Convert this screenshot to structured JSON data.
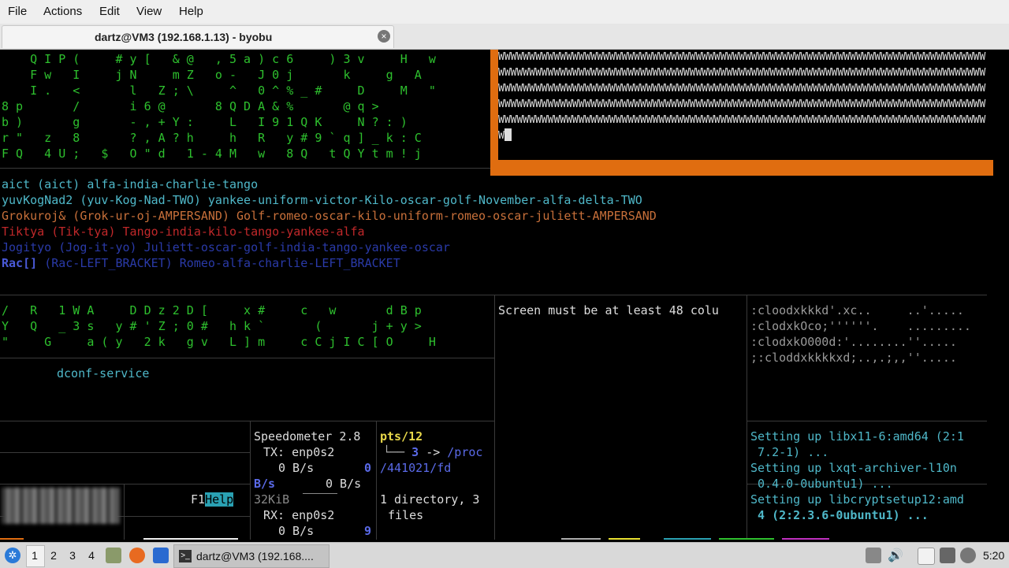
{
  "menu": {
    "file": "File",
    "actions": "Actions",
    "edit": "Edit",
    "view": "View",
    "help": "Help"
  },
  "tab": {
    "title": "dartz@VM3 (192.168.1.13) - byobu",
    "close_icon": "close-icon"
  },
  "matrix_top": [
    "    Q I P (     # y [   & @   , 5 a ) c 6     ) 3 v     H   w",
    "    F w   I     j N     m Z   o -   J 0 j       k     g   A",
    "    I .   <       l   Z ; \\     ^   0 ^ % _ #     D     M   \"",
    "8 p       /       i 6 @       8 Q D A & %       @ q >",
    "b )       g       - , + Y :     L   I 9 1 Q K     N ? : )",
    "r \"   z   8       ? , A ? h     h   R   y # 9 ` q ] _ k : C",
    "F Q   4 U ;   $   O \" d   1 - 4 M   w   8 Q   t Q Y t m ! j"
  ],
  "wpane": {
    "lines": [
      "WWWWWWWWWWWWWWWWWWWWWWWWWWWWWWWWWWWWWWWWWWWWWWWWWWWWWWWWWWWWWWWWWWWWWWWWWWWWWWW",
      "WWWWWWWWWWWWWWWWWWWWWWWWWWWWWWWWWWWWWWWWWWWWWWWWWWWWWWWWWWWWWWWWWWWWWWWWWWWWWWW",
      "WWWWWWWWWWWWWWWWWWWWWWWWWWWWWWWWWWWWWWWWWWWWWWWWWWWWWWWWWWWWWWWWWWWWWWWWWWWWWWW",
      "WWWWWWWWWWWWWWWWWWWWWWWWWWWWWWWWWWWWWWWWWWWWWWWWWWWWWWWWWWWWWWWWWWWWWWWWWWWWWWW",
      "WWWWWWWWWWWWWWWWWWWWWWWWWWWWWWWWWWWWWWWWWWWWWWWWWWWWWWWWWWWWWWWWWWWWWWWWWWWWWWW"
    ],
    "last": "W"
  },
  "tokens": [
    {
      "text": "aict (aict) alfa-india-charlie-tango",
      "color": "#4fb8c9"
    },
    {
      "text": "yuvKogNad2 (yuv-Kog-Nad-TWO) yankee-uniform-victor-Kilo-oscar-golf-November-alfa-delta-TWO",
      "color": "#4fb8c9"
    },
    {
      "text": "Grokuroj& (Grok-ur-oj-AMPERSAND) Golf-romeo-oscar-kilo-uniform-romeo-oscar-juliett-AMPERSAND",
      "color": "#c8703a"
    },
    {
      "text": "Tiktya (Tik-tya) Tango-india-kilo-tango-yankee-alfa",
      "color": "#c0282a"
    },
    {
      "text": "Jogityo (Jog-it-yo) Juliett-oscar-golf-india-tango-yankee-oscar",
      "color": "#2a3aa8"
    },
    {
      "text": "(Rac-LEFT_BRACKET) Romeo-alfa-charlie-LEFT_BRACKET",
      "color": "#2a3aa8",
      "prefix": "Rac[]"
    }
  ],
  "matrix_mid": [
    "/   R   1 W A     D D z 2 D [     x #     c   w       d B p",
    "Y   Q   _ 3 s   y # ' Z ; 0 #   h k `       (       j + y >",
    "\"     G     a ( y   2 k   g v   L ] m     c C j I C [ O     H"
  ],
  "dconf": "dconf-service",
  "screen_msg": "Screen must be at least 48 colu",
  "ascii_art": [
    ":cloodxkkkd'.xc..     ..'.....",
    ":clodxkOco;''''''.    .........",
    ":clodxkO000d:'........''.....",
    ";:cloddxkkkkxd;..,.;,,''....."
  ],
  "speedometer": {
    "title": "Speedometer 2.8",
    "tx_label": "TX: enp0s2",
    "tx_rate": "0 B/s",
    "tx_val": "0",
    "bs_left": "B/s",
    "bs_right": "0 B/s",
    "scale": "32KiB",
    "rx_label": "RX: enp0s2",
    "rx_rate": "0 B/s",
    "rx_val": "9"
  },
  "tree": {
    "root": "pts/12",
    "branch": "└──",
    "num": "3",
    "arrow": "->",
    "path1": "/proc",
    "path2": "/441021/fd",
    "summary1": "1 directory, 3",
    "summary2": "files"
  },
  "f1help": {
    "key": "F1",
    "label": "Help"
  },
  "apt": [
    {
      "prefix": "Setting up ",
      "text": "libx11-6:amd64 (2:1"
    },
    {
      "prefix": " ",
      "text": "7.2-1) ..."
    },
    {
      "prefix": "Setting up ",
      "text": "lxqt-archiver-l10n"
    },
    {
      "prefix": " ",
      "text": "0.4.0-0ubuntu1) ..."
    },
    {
      "prefix": "Setting up ",
      "text": "libcryptsetup12:amd"
    },
    {
      "prefix": " ",
      "text": "4 (2:2.3.6-0ubuntu1) ..."
    }
  ],
  "taskbar": {
    "desktops": [
      "1",
      "2",
      "3",
      "4"
    ],
    "task_title": "dartz@VM3 (192.168....",
    "clock": "5:20"
  },
  "colors": {
    "accent_orange": "#e06d10",
    "matrix_green": "#2ec02e",
    "taskbar_bg": "#d9d9d9"
  }
}
